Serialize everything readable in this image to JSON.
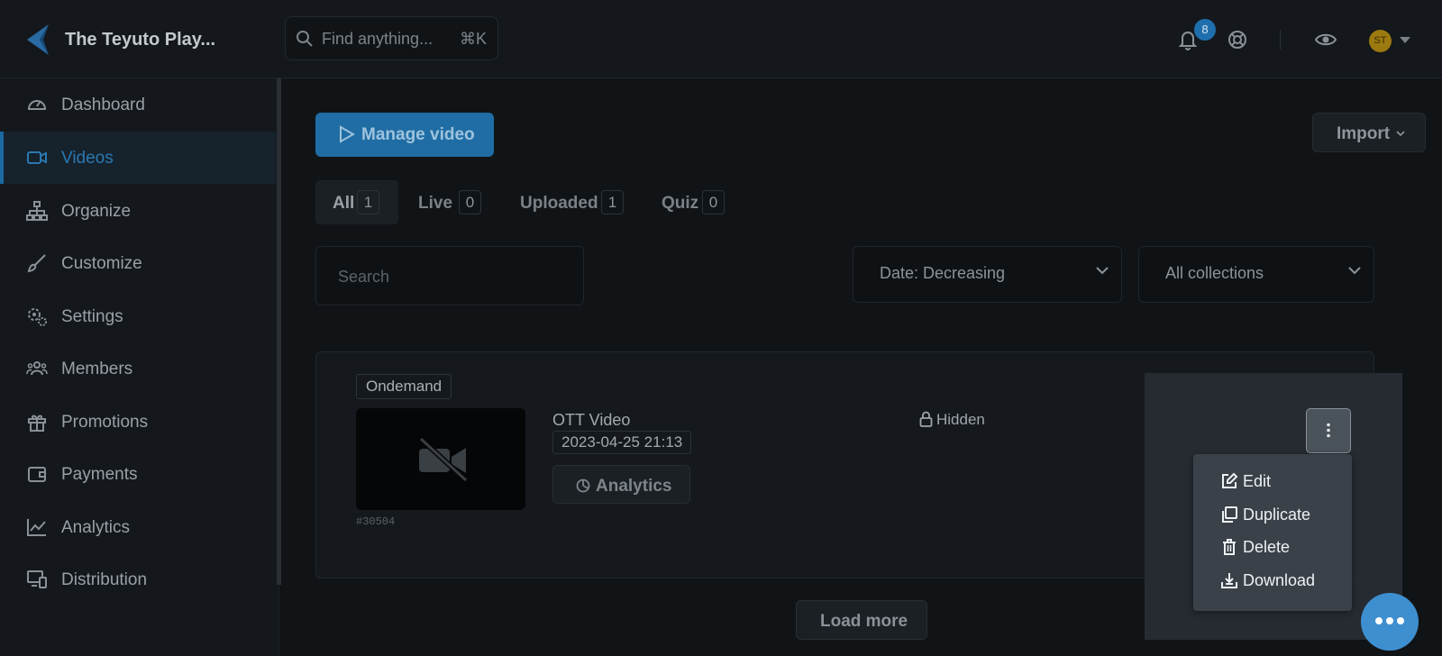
{
  "header": {
    "brand": "The Teyuto Play...",
    "search_placeholder": "Find anything...",
    "search_shortcut": "⌘K",
    "notification_count": "8",
    "avatar_initials": "ST"
  },
  "sidebar": {
    "items": [
      {
        "label": "Dashboard",
        "icon": "gauge-icon",
        "active": false
      },
      {
        "label": "Videos",
        "icon": "video-camera-icon",
        "active": true
      },
      {
        "label": "Organize",
        "icon": "sitemap-icon",
        "active": false
      },
      {
        "label": "Customize",
        "icon": "brush-icon",
        "active": false
      },
      {
        "label": "Settings",
        "icon": "gears-icon",
        "active": false
      },
      {
        "label": "Members",
        "icon": "users-icon",
        "active": false
      },
      {
        "label": "Promotions",
        "icon": "gift-icon",
        "active": false
      },
      {
        "label": "Payments",
        "icon": "wallet-icon",
        "active": false
      },
      {
        "label": "Analytics",
        "icon": "line-chart-icon",
        "active": false
      },
      {
        "label": "Distribution",
        "icon": "devices-icon",
        "active": false
      }
    ]
  },
  "main": {
    "manage_label": "Manage video",
    "import_label": "Import",
    "tabs": [
      {
        "label": "All",
        "count": "1",
        "active": true
      },
      {
        "label": "Live",
        "count": "0",
        "active": false
      },
      {
        "label": "Uploaded",
        "count": "1",
        "active": false
      },
      {
        "label": "Quiz",
        "count": "0",
        "active": false
      }
    ],
    "search_placeholder": "Search",
    "sort_value": "Date: Decreasing",
    "collection_value": "All collections",
    "load_more_label": "Load more"
  },
  "video": {
    "tag": "Ondemand",
    "id": "#30504",
    "title": "OTT Video",
    "date": "2023-04-25 21:13",
    "analytics_label": "Analytics",
    "visibility": "Hidden"
  },
  "context_menu": {
    "items": [
      {
        "label": "Edit",
        "icon": "edit-icon"
      },
      {
        "label": "Duplicate",
        "icon": "copy-icon"
      },
      {
        "label": "Delete",
        "icon": "trash-icon"
      },
      {
        "label": "Download",
        "icon": "download-icon"
      }
    ]
  },
  "colors": {
    "accent": "#1f6da4",
    "background": "#111417",
    "sidebar": "#14181c",
    "avatar": "#9c7a0f",
    "chat": "#3e8fd0"
  }
}
